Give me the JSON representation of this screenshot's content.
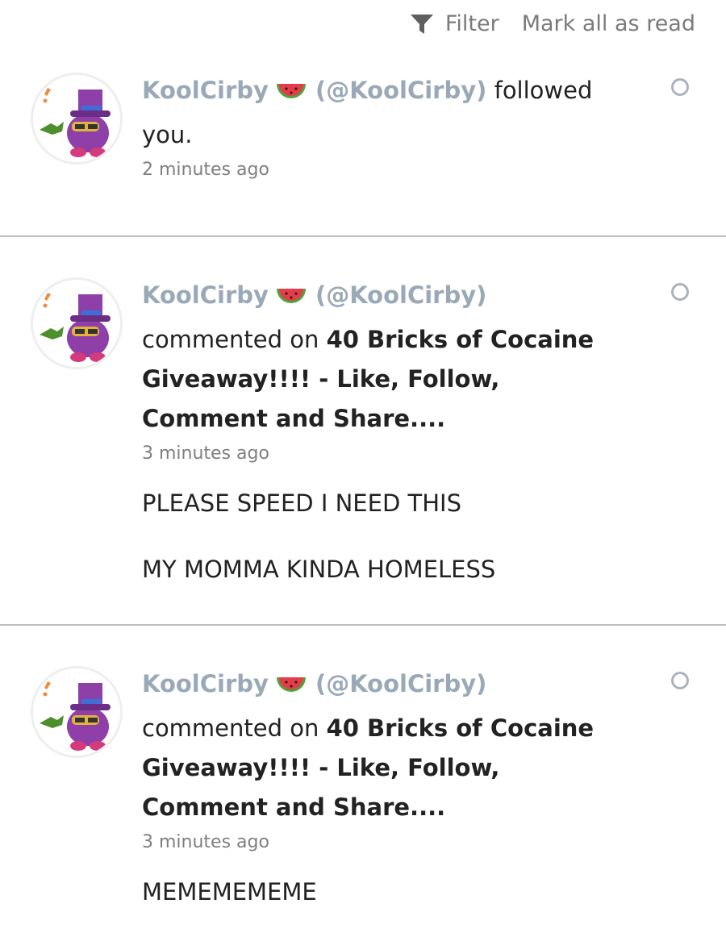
{
  "toolbar": {
    "filter_label": "Filter",
    "mark_all_label": "Mark all as read"
  },
  "notifications": [
    {
      "user": "KoolCirby",
      "handle": "(@KoolCirby)",
      "action": "followed",
      "action_cont": "you.",
      "time": "2 minutes ago"
    },
    {
      "user": "KoolCirby",
      "handle": "(@KoolCirby)",
      "action": "commented on",
      "post_line1": "40 Bricks of Cocaine",
      "post_line2": "Giveaway!!!! - Like, Follow,",
      "post_line3": "Comment and Share....",
      "time": "3 minutes ago",
      "comment_line1": "PLEASE SPEED I NEED THIS",
      "comment_line2": "MY MOMMA KINDA HOMELESS"
    },
    {
      "user": "KoolCirby",
      "handle": "(@KoolCirby)",
      "action": "commented on",
      "post_line1": "40 Bricks of Cocaine",
      "post_line2": "Giveaway!!!! - Like, Follow,",
      "post_line3": "Comment and Share....",
      "time": "3 minutes ago",
      "comment_line1": "MEMEMEMEME"
    }
  ],
  "icons": {
    "filter": "filter-icon",
    "emoji": "watermelon-emoji-icon",
    "avatar": "purple-kirby-avatar"
  },
  "colors": {
    "username": "#9aa9b8",
    "meta": "#7f7f7f",
    "divider": "#bdbdbd",
    "unread_dot_border": "#aab3bc"
  }
}
